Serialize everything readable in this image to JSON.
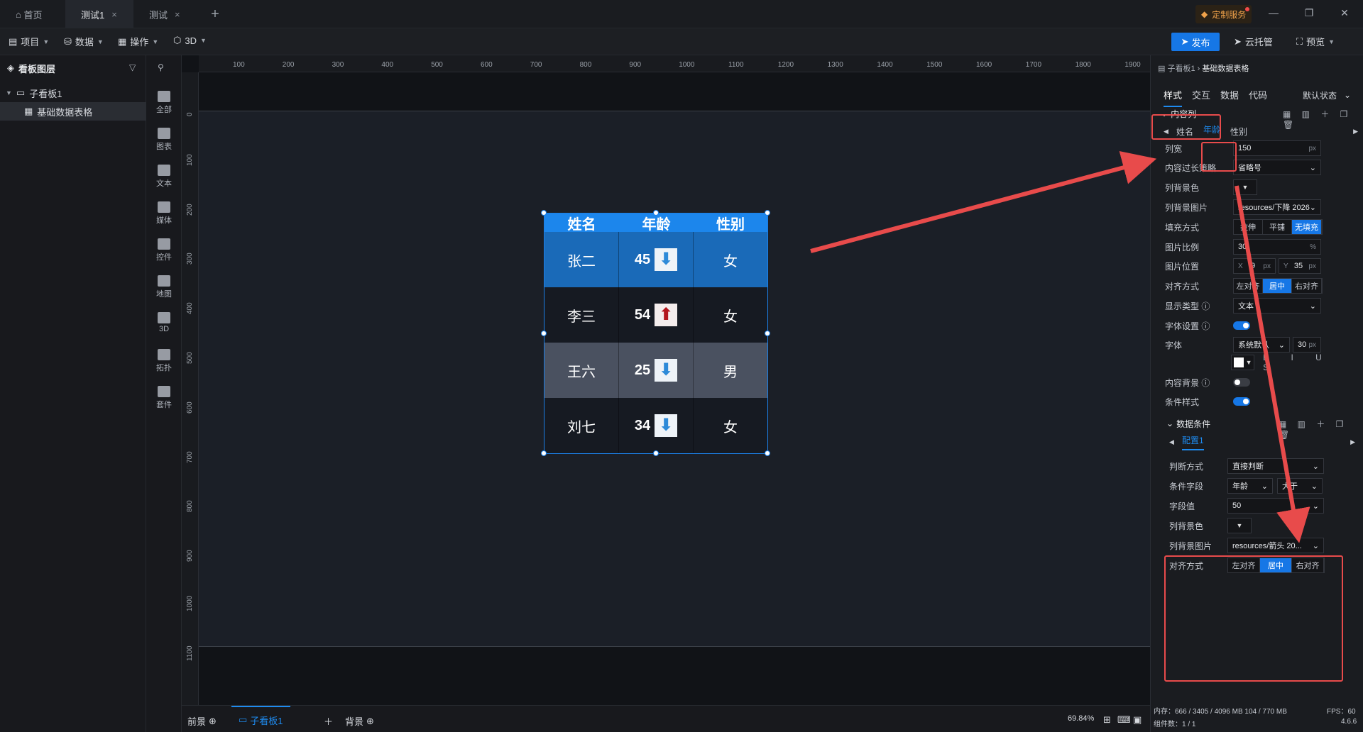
{
  "tabs": {
    "home": "首页",
    "t1": "测试1",
    "t2": "测试"
  },
  "custom_service": "定制服务",
  "toolbar": {
    "project": "项目",
    "data": "数据",
    "operate": "操作",
    "three_d": "3D",
    "publish": "发布",
    "cloud": "云托管",
    "preview": "预览"
  },
  "layers": {
    "title": "看板图层",
    "board": "子看板1",
    "item": "基础数据表格"
  },
  "cats": [
    "全部",
    "图表",
    "文本",
    "媒体",
    "控件",
    "地图",
    "3D",
    "拓扑",
    "套件"
  ],
  "ruler_top": [
    "100",
    "200",
    "300",
    "400",
    "500",
    "600",
    "700",
    "800",
    "900",
    "1000",
    "1100",
    "1200",
    "1300",
    "1400",
    "1500",
    "1600",
    "1700",
    "1800",
    "1900"
  ],
  "ruler_left": [
    "0",
    "100",
    "200",
    "300",
    "400",
    "500",
    "600",
    "700",
    "800",
    "900",
    "1000",
    "1100"
  ],
  "table": {
    "headers": [
      "姓名",
      "年龄",
      "性别"
    ],
    "rows": [
      {
        "name": "张二",
        "age": "45",
        "arrow": "down",
        "gender": "女",
        "bg": "#1a6ab8"
      },
      {
        "name": "李三",
        "age": "54",
        "arrow": "up",
        "gender": "女",
        "bg": "#161a22"
      },
      {
        "name": "王六",
        "age": "25",
        "arrow": "down",
        "gender": "男",
        "bg": "#4a5160"
      },
      {
        "name": "刘七",
        "age": "34",
        "arrow": "down",
        "gender": "女",
        "bg": "#161a22"
      }
    ]
  },
  "bottom": {
    "front": "前景",
    "board": "子看板1",
    "back": "背景",
    "zoom": "69.84%"
  },
  "props": {
    "bread_1": "子看板1",
    "bread_2": "基础数据表格",
    "tabs": [
      "样式",
      "交互",
      "数据",
      "代码"
    ],
    "state": "默认状态",
    "section": "内容列",
    "col_tabs": [
      "姓名",
      "年龄",
      "性别"
    ],
    "col_width_label": "列宽",
    "col_width": "150",
    "px": "px",
    "overflow_label": "内容过长策略",
    "overflow": "省略号",
    "bgcolor_label": "列背景色",
    "bgimg_label": "列背景图片",
    "bgimg": "resources/下降 2026-...",
    "fill_label": "填充方式",
    "fill": [
      "拉伸",
      "平铺",
      "无填充"
    ],
    "ratio_label": "图片比例",
    "ratio": "30",
    "pct": "%",
    "pos_label": "图片位置",
    "pos_x_label": "X",
    "pos_x": "9",
    "pos_y_label": "Y",
    "pos_y": "35",
    "align_label": "对齐方式",
    "align": [
      "左对齐",
      "居中",
      "右对齐"
    ],
    "display_label": "显示类型",
    "display": "文本",
    "font_set_label": "字体设置",
    "font_label": "字体",
    "font": "系统默认",
    "font_size": "30",
    "content_bg_label": "内容背景",
    "cond_label": "条件样式",
    "cond_section": "数据条件",
    "config_tab": "配置1",
    "judge_label": "判断方式",
    "judge": "直接判断",
    "field_label": "条件字段",
    "field": "年龄",
    "op": "大于",
    "value_label": "字段值",
    "value": "50",
    "c_bgcolor_label": "列背景色",
    "c_bgimg_label": "列背景图片",
    "c_bgimg": "resources/箭头 20...",
    "c_align_label": "对齐方式",
    "c_align": [
      "左对齐",
      "居中",
      "右对齐"
    ]
  },
  "status": {
    "mem": "内存：666 / 3405 / 4096 MB  104 / 770 MB",
    "fps": "FPS：60",
    "count": "组件数：1 / 1",
    "version": "4.6.6"
  }
}
